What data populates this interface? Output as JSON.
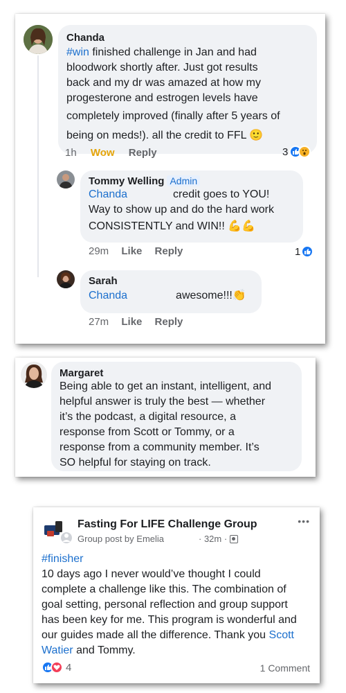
{
  "comment1": {
    "author": "Chanda",
    "hashtag": "#win",
    "text_line1": " finished challenge in Jan and had",
    "text_lines": [
      "bloodwork shortly after.  Just got results",
      "back and my dr was amazed at how my",
      "progesterone and estrogen levels have",
      "completely improved (finally after 5 years of",
      "being on meds!).  all the credit to FFL 🙂"
    ],
    "time": "1h",
    "reaction_label": "Wow",
    "reply_label": "Reply",
    "reaction_count": "3"
  },
  "reply1": {
    "author": "Tommy Welling",
    "badge": "Admin",
    "mention": "Chanda",
    "text_after_mention": "credit goes to YOU!",
    "text_lines": [
      "Way to show up and do the hard work",
      "CONSISTENTLY and WIN!! 💪💪"
    ],
    "time": "29m",
    "like_label": "Like",
    "reply_label": "Reply",
    "reaction_count": "1"
  },
  "reply2": {
    "author": "Sarah",
    "mention": "Chanda",
    "text_after_mention": "awesome!!!👏",
    "time": "27m",
    "like_label": "Like",
    "reply_label": "Reply"
  },
  "comment2": {
    "author": "Margaret",
    "text_lines": [
      "Being able to get an instant, intelligent, and",
      "helpful answer is truly the best — whether",
      "it’s the podcast, a digital resource, a",
      "response from Scott or Tommy, or a",
      "response from a community member. It’s",
      "SO helpful for staying on track."
    ]
  },
  "post": {
    "group_name": "Fasting For LIFE Challenge Group",
    "subtitle": "Group post by Emelia",
    "time": "· 32m ·",
    "hashtag": "#finisher",
    "text_lines": [
      "10 days ago I never would’ve thought I could",
      "complete a challenge like this.  The combination of",
      "goal setting, personal reflection and group support",
      "has been key for me. This program is wonderful and"
    ],
    "line5_text": "our guides made all the difference. Thank you ",
    "mention1": "Scott",
    "mention2": "Watier",
    "line6_text": " and Tommy.",
    "reaction_count": "4",
    "comment_count": "1 Comment",
    "more_label": "•••"
  },
  "colors": {
    "link": "#1b6fcd",
    "bubble": "#f0f2f5",
    "meta": "#65676b",
    "wow": "#e5a50a"
  }
}
